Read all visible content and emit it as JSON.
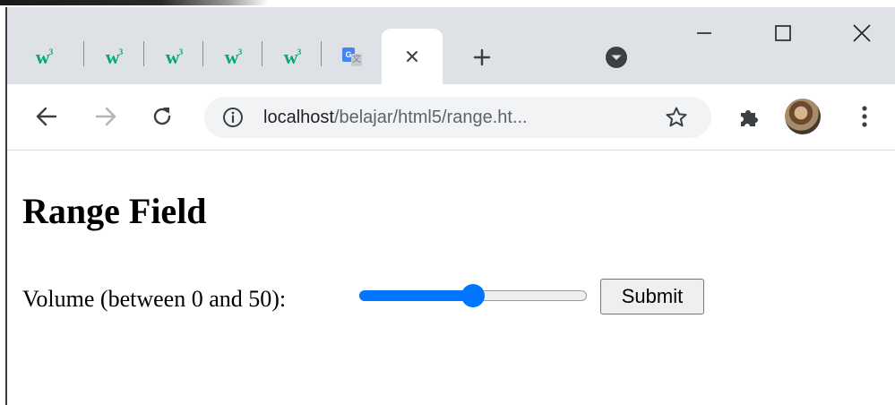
{
  "browser": {
    "tabs": [
      {
        "icon": "w3schools-favicon",
        "glyph": "w",
        "superscript": "3"
      },
      {
        "icon": "w3schools-favicon",
        "glyph": "w",
        "superscript": "3"
      },
      {
        "icon": "w3schools-favicon",
        "glyph": "w",
        "superscript": "3"
      },
      {
        "icon": "w3schools-favicon",
        "glyph": "w",
        "superscript": "3"
      },
      {
        "icon": "w3schools-favicon",
        "glyph": "w",
        "superscript": "3"
      },
      {
        "icon": "google-translate-favicon",
        "glyph": "G",
        "secondary_glyph": "文"
      }
    ],
    "active_tab": {
      "close_icon": "close-icon"
    },
    "new_tab_icon": "plus-icon",
    "tab_search_icon": "chevron-down-circle-icon",
    "window_controls": {
      "minimize": "minimize-icon",
      "maximize": "maximize-icon",
      "close": "close-icon"
    },
    "toolbar": {
      "back": "arrow-left-icon",
      "forward": "arrow-right-icon",
      "reload": "reload-icon",
      "site_info": "info-icon",
      "url_host": "localhost",
      "url_path": "/belajar/html5/range.ht...",
      "bookmark": "star-icon",
      "extensions": "puzzle-icon",
      "profile": "avatar",
      "menu": "kebab-menu-icon"
    },
    "colors": {
      "tabstrip": "#dee1e6",
      "omnibox": "#f1f3f4",
      "w3_green": "#04aa6d",
      "accent": "#0075ff"
    }
  },
  "page": {
    "title": "Range Field",
    "label": "Volume (between 0 and 50):",
    "range": {
      "min": 0,
      "max": 50,
      "value": 25
    },
    "submit_label": "Submit"
  }
}
